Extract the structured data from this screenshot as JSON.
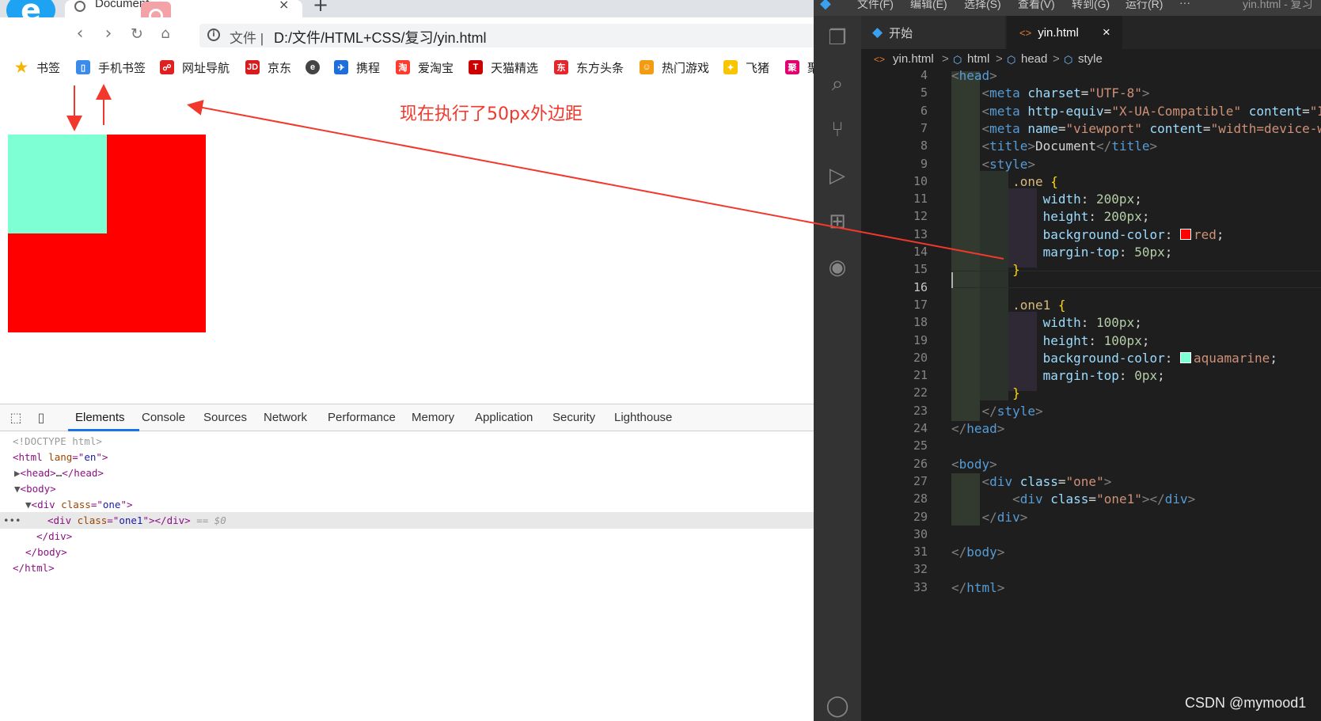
{
  "browser": {
    "tab_title": "Document",
    "tab_close": "×",
    "new_tab": "+",
    "address_label": "文件",
    "address_separator": "|",
    "url": "D:/文件/HTML+CSS/复习/yin.html",
    "bookmarks": [
      {
        "label": "书签",
        "icon": "star-icon",
        "color": "#f5b400"
      },
      {
        "label": "手机书签",
        "icon": "phone-icon",
        "color": "#3b8beb"
      },
      {
        "label": "网址导航",
        "icon": "navigation-icon",
        "color": "#e02020"
      },
      {
        "label": "京东",
        "icon": "jd-icon",
        "color": "#d71c1e"
      },
      {
        "label": "",
        "icon": "e-circle-icon",
        "color": "#444444"
      },
      {
        "label": "携程",
        "icon": "ctrip-icon",
        "color": "#1e6fd9"
      },
      {
        "label": "爱淘宝",
        "icon": "taobao-icon",
        "color": "#ff3d2e"
      },
      {
        "label": "天猫精选",
        "icon": "tmall-icon",
        "color": "#cc0000"
      },
      {
        "label": "东方头条",
        "icon": "dftt-icon",
        "color": "#e4252c"
      },
      {
        "label": "热门游戏",
        "icon": "game-icon",
        "color": "#f39c12"
      },
      {
        "label": "飞猪",
        "icon": "fliggy-icon",
        "color": "#f7c600"
      },
      {
        "label": "聚",
        "icon": "ju-icon",
        "color": "#e3006e"
      }
    ],
    "annotation": "现在执行了50px外边距",
    "colors": {
      "one": "#ff0000",
      "one1": "#7fffd4",
      "annotation": "#f2382c"
    }
  },
  "devtools": {
    "tabs": [
      "Elements",
      "Console",
      "Sources",
      "Network",
      "Performance",
      "Memory",
      "Application",
      "Security",
      "Lighthouse"
    ],
    "active_tab": "Elements",
    "dom": {
      "doctype": "<!DOCTYPE html>",
      "html_tag": "html",
      "lang_attr": "lang",
      "lang_val": "en",
      "head_tag": "head",
      "head_ellipsis": "…",
      "body_tag": "body",
      "div_tag": "div",
      "class_attr": "class",
      "one_val": "one",
      "one1_val": "one1",
      "selected_suffix": "== $0",
      "more": "•••"
    }
  },
  "vscode": {
    "title_menus": [
      "文件(F)",
      "编辑(E)",
      "选择(S)",
      "查看(V)",
      "转到(G)",
      "运行(R)",
      "···"
    ],
    "title_right": "yin.html - 复习",
    "tabs": [
      {
        "label": "开始"
      },
      {
        "label": "yin.html",
        "close": "×"
      }
    ],
    "breadcrumb": [
      "yin.html",
      "html",
      "head",
      "style"
    ],
    "breadcrumb_sep": ">",
    "line_numbers": [
      4,
      5,
      6,
      7,
      8,
      9,
      10,
      11,
      12,
      13,
      14,
      15,
      16,
      17,
      18,
      19,
      20,
      21,
      22,
      23,
      24,
      25,
      26,
      27,
      28,
      29,
      30,
      31,
      32,
      33
    ],
    "current_line": 16,
    "code": {
      "l4": "<head>",
      "l5_tag": "meta",
      "l5_attr": "charset",
      "l5_val": "\"UTF-8\"",
      "l6_tag": "meta",
      "l6_attr1": "http-equiv",
      "l6_val1": "\"X-UA-Compatible\"",
      "l6_attr2": "content",
      "l6_val2": "\"IE=e",
      "l7_tag": "meta",
      "l7_attr1": "name",
      "l7_val1": "\"viewport\"",
      "l7_attr2": "content",
      "l7_val2": "\"width=device-widt",
      "l8_tag": "title",
      "l8_text": "Document",
      "l9_tag": "style",
      "l10_sel": ".one",
      "l11_prop": "width",
      "l11_num": "200px",
      "l12_prop": "height",
      "l12_num": "200px",
      "l13_prop": "background-color",
      "l13_val": "red",
      "l14_prop": "margin-top",
      "l14_num": "50px",
      "l17_sel": ".one1",
      "l18_prop": "width",
      "l18_num": "100px",
      "l19_prop": "height",
      "l19_num": "100px",
      "l20_prop": "background-color",
      "l20_val": "aquamarine",
      "l21_prop": "margin-top",
      "l21_num": "0px",
      "l23_tag": "style",
      "l24_tag": "head",
      "l26_tag": "body",
      "l27_tag": "div",
      "l27_attr": "class",
      "l27_val": "\"one\"",
      "l28_tag": "div",
      "l28_attr": "class",
      "l28_val": "\"one1\"",
      "l29_tag": "div",
      "l31_tag": "body",
      "l33_tag": "html"
    },
    "swatch_colors": {
      "red": "#ff0000",
      "aquamarine": "#7fffd4"
    }
  },
  "watermark": "CSDN @mymood1"
}
